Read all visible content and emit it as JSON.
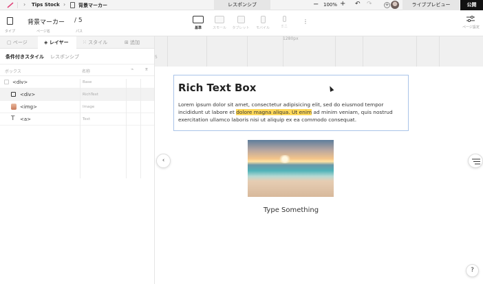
{
  "topbar": {
    "project": "Tips Stock",
    "page": "背景マーカー",
    "responsive_tab": "レスポンシブ",
    "zoom": "100%",
    "live_preview": "ライブプレビュー",
    "publish": "公開"
  },
  "toolbar": {
    "type_label": "タイプ",
    "page_name": "背景マーカー",
    "page_name_label": "ページ名",
    "path": "/ 5",
    "path_label": "パス",
    "devices": [
      {
        "label": "基準",
        "active": true
      },
      {
        "label": "スモール",
        "active": false
      },
      {
        "label": "タブレット",
        "active": false
      },
      {
        "label": "モバイル",
        "active": false
      },
      {
        "label": "ミニ",
        "active": false
      }
    ],
    "page_settings": "ページ設定"
  },
  "sidebar": {
    "tabs": [
      "ページ",
      "レイヤー",
      "スタイル",
      "追加"
    ],
    "subtabs": [
      "条件付きスタイル",
      "レスポンシブ"
    ],
    "col_box": "ボックス",
    "col_name": "名称",
    "rows": [
      {
        "name": "<div>",
        "class": "Base"
      },
      {
        "name": "<div>",
        "class": "RichText"
      },
      {
        "name": "<img>",
        "class": "Image"
      },
      {
        "name": "<a>",
        "class": "Text"
      }
    ]
  },
  "canvas": {
    "ruler_label": "1280px",
    "rich_text_title": "Rich Text Box",
    "body_before": "Lorem ipsum dolor sit amet, consectetur adipisicing elit, sed do eiusmod tempor incididunt ut labore et ",
    "body_highlight": "dolore magna aliqua. Ut enim",
    "body_after": " ad minim veniam, quis nostrud exercitation ullamco laboris nisi ut aliquip ex ea commodo consequat.",
    "type_something": "Type Something",
    "help": "?"
  },
  "colors": {
    "highlight": "#ffd95a",
    "selection_border": "#a9c3e8",
    "publish_bg": "#111111"
  }
}
